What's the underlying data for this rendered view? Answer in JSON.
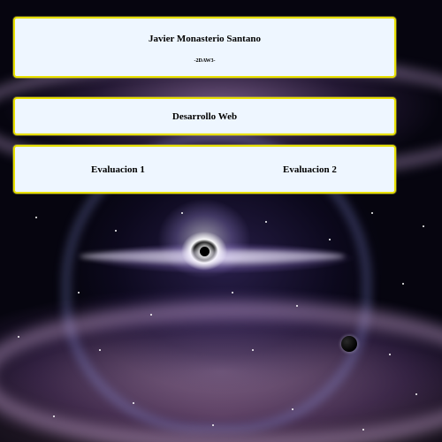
{
  "header": {
    "name": "Javier Monasterio Santano",
    "group": "-2DAW3-"
  },
  "subject": {
    "title": "Desarrollo Web"
  },
  "evaluations": {
    "items": [
      {
        "label": "Evaluacion 1"
      },
      {
        "label": "Evaluacion 2"
      }
    ]
  },
  "colors": {
    "panel_background": "#eef6ff",
    "panel_border": "#e8e000",
    "text": "#000000"
  }
}
